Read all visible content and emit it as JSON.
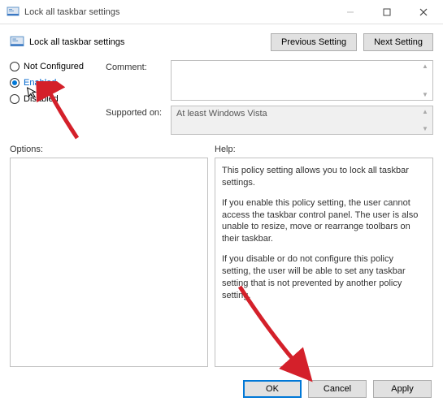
{
  "window": {
    "title": "Lock all taskbar settings"
  },
  "header": {
    "policy_title": "Lock all taskbar settings",
    "prev_btn": "Previous Setting",
    "next_btn": "Next Setting"
  },
  "radios": {
    "not_configured": "Not Configured",
    "enabled": "Enabled",
    "disabled": "Disabled"
  },
  "fields": {
    "comment_label": "Comment:",
    "supported_label": "Supported on:",
    "supported_value": "At least Windows Vista"
  },
  "section_labels": {
    "options": "Options:",
    "help": "Help:"
  },
  "help": {
    "p1": "This policy setting allows you to lock all taskbar settings.",
    "p2": "If you enable this policy setting, the user cannot access the taskbar control panel. The user is also unable to resize, move or rearrange toolbars on their taskbar.",
    "p3": "If you disable or do not configure this policy setting, the user will be able to set any taskbar setting that is not prevented by another policy setting."
  },
  "buttons": {
    "ok": "OK",
    "cancel": "Cancel",
    "apply": "Apply"
  }
}
